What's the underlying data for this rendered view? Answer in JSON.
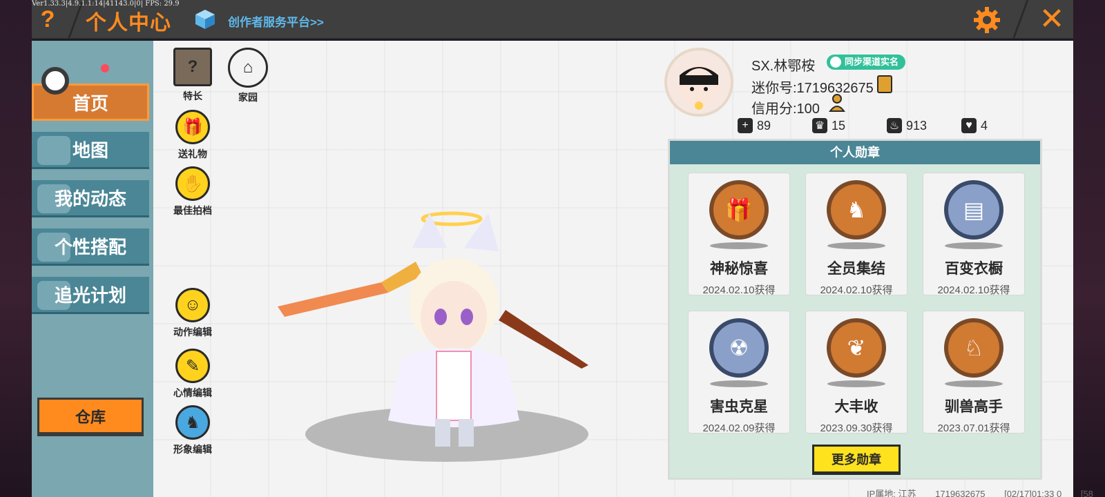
{
  "debug": {
    "text": "Ver1.33.3|4.9.1.1:14|41143.0|0| FPS: 29.9"
  },
  "header": {
    "help_label": "?",
    "title": "个人中心",
    "creator_link": "创作者服务平台>>",
    "close_label": "✕"
  },
  "sidebar": {
    "items": [
      {
        "label": "首页",
        "icon": "home-icon"
      },
      {
        "label": "地图",
        "icon": "map-icon"
      },
      {
        "label": "我的动态",
        "icon": "bell-icon"
      },
      {
        "label": "个性搭配",
        "icon": "outfit-icon"
      },
      {
        "label": "追光计划",
        "icon": "light-plan-icon"
      }
    ],
    "warehouse_label": "仓库"
  },
  "tools": {
    "skills": "特长",
    "home": "家园",
    "gift": "送礼物",
    "partner": "最佳拍档",
    "action_edit": "动作编辑",
    "mood_edit": "心情编辑",
    "look_edit": "形象编辑"
  },
  "profile": {
    "nickname": "SX.林鄂桉",
    "sync_badge": "同步渠道实名",
    "mini_id": "迷你号:1719632675",
    "credit": "信用分:100",
    "stats": [
      {
        "icon": "plus-icon",
        "value": "89"
      },
      {
        "icon": "trophy-icon",
        "value": "15"
      },
      {
        "icon": "flame-icon",
        "value": "913"
      },
      {
        "icon": "heart-icon",
        "value": "4"
      }
    ]
  },
  "medals": {
    "title": "个人勋章",
    "items": [
      {
        "name": "神秘惊喜",
        "date": "2024.02.10获得",
        "style": "bronze"
      },
      {
        "name": "全员集结",
        "date": "2024.02.10获得",
        "style": "bronze"
      },
      {
        "name": "百变衣橱",
        "date": "2024.02.10获得",
        "style": "steel"
      },
      {
        "name": "害虫克星",
        "date": "2024.02.09获得",
        "style": "steel"
      },
      {
        "name": "大丰收",
        "date": "2023.09.30获得",
        "style": "bronze"
      },
      {
        "name": "驯兽高手",
        "date": "2023.07.01获得",
        "style": "bronze"
      }
    ],
    "more_label": "更多勋章"
  },
  "footer": {
    "ip_location": "IP属地: 江苏",
    "uid": "1719632675",
    "timestamp": "[02/17]01:33 0",
    "tail": "[58"
  },
  "colors": {
    "accent": "#ff8a1e",
    "teal": "#4a8696",
    "yellow": "#ffd21e",
    "link": "#5fb8ea"
  }
}
